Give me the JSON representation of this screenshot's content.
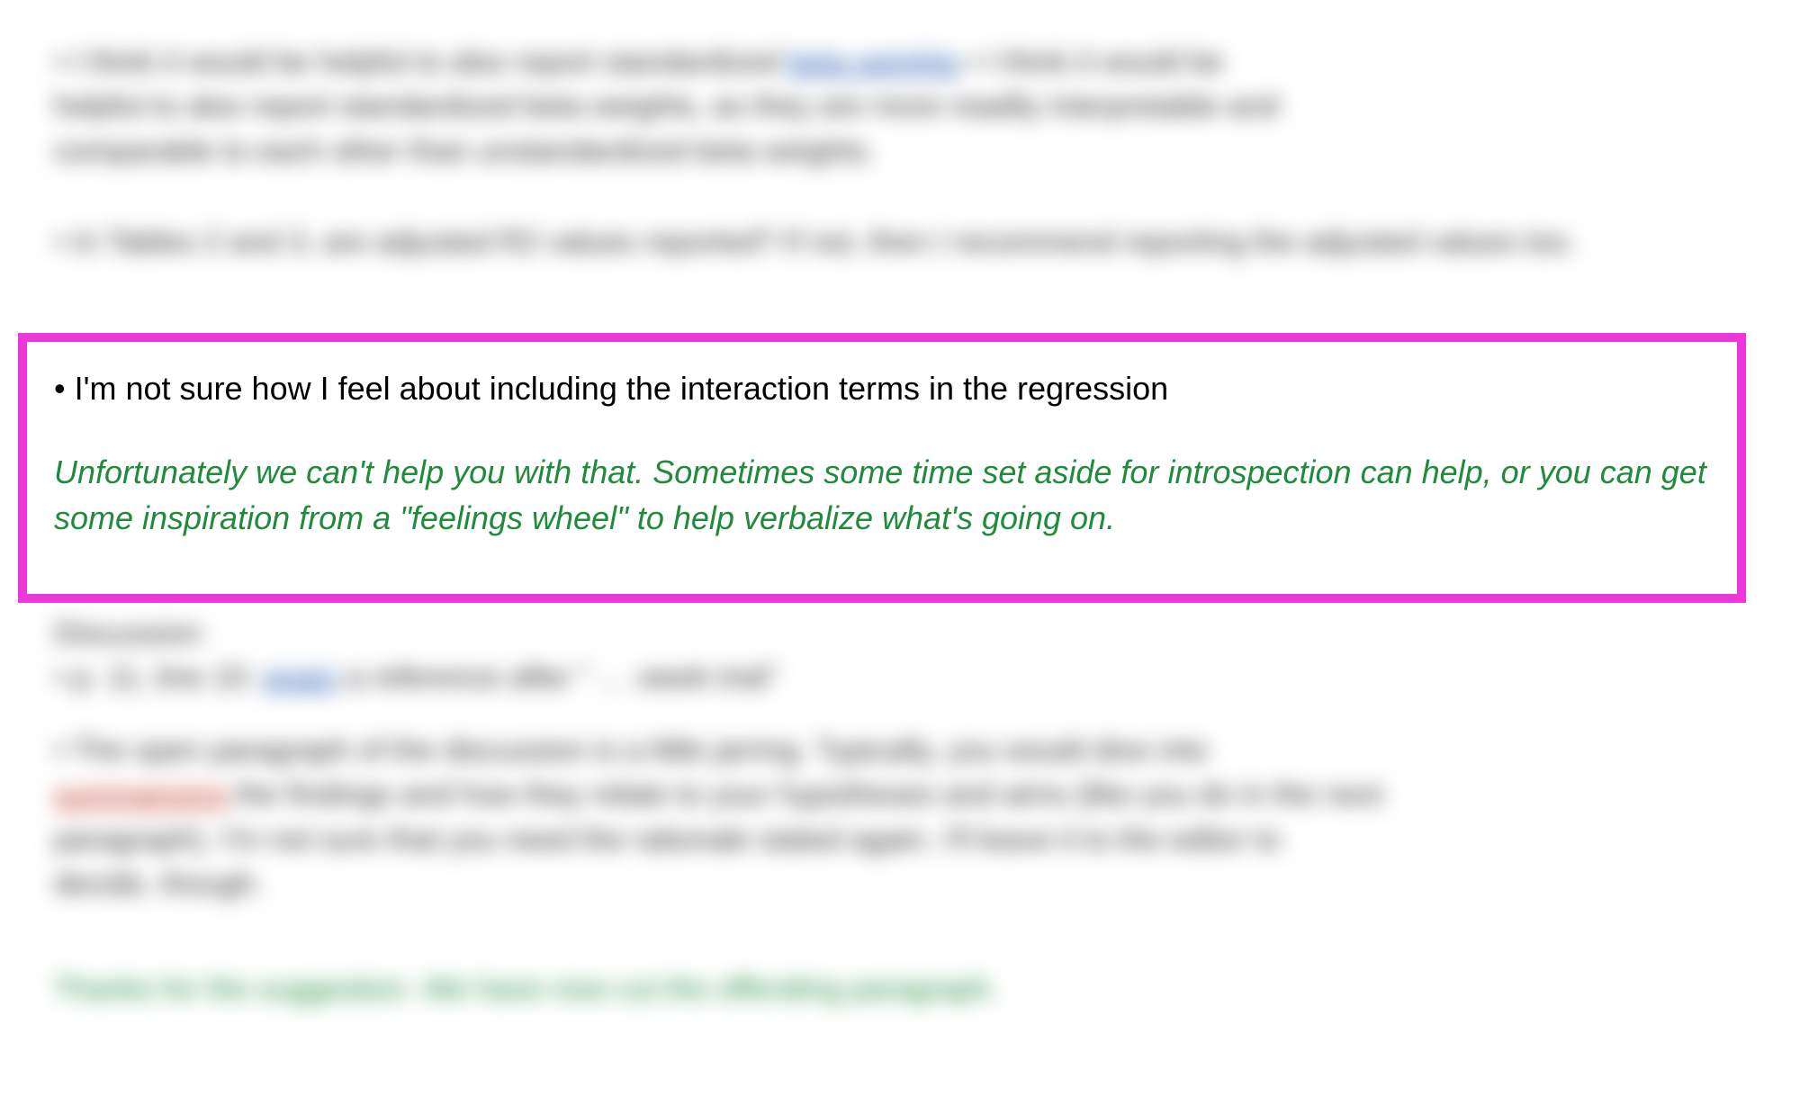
{
  "highlight": {
    "comment_text": "• I'm not sure how I feel about including the interaction terms in the regression",
    "reply_text": "Unfortunately we can't help you with that. Sometimes some time set aside for introspection can help, or you can get some inspiration from a \"feelings wheel\" to help verbalize what's going on."
  },
  "blurred": {
    "p1": "• I think it would be helpful to also report standardized beta weights, as they are more readily interpretable and comparable to each other than unstandardized beta weights.",
    "p2": "• In Tables 2 and 3, are adjusted R2 values reported? If not, then I recommend reporting the adjusted values too.",
    "p3_a": "Discussion",
    "p3_b": "• p. 11, line 10: again a reference after \"… week trial\"",
    "p4": "• The open paragraph of the discussion is a little jarring. Typically, you would dive into summarizing the findings and how they relate to your hypotheses and aims (like you do in the next paragraph). I'm not sure that you need the rationale stated again.  I'll leave it to the editor to decide, though.",
    "p5": "Thanks for the suggestion. We have now cut the offending paragraph."
  }
}
